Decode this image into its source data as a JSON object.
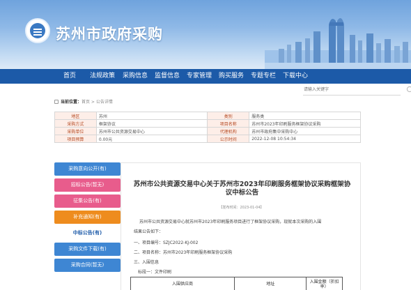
{
  "header": {
    "site_title": "苏州市政府采购"
  },
  "nav": {
    "items": [
      "首页",
      "法规政策",
      "采购信息",
      "监督信息",
      "专家管理",
      "购买服务",
      "专题专栏",
      "下载中心"
    ]
  },
  "search": {
    "placeholder": "请输入关键字"
  },
  "breadcrumb": {
    "label": "当前位置：",
    "path": "首页 > 公告详情"
  },
  "info_table": {
    "rows": [
      {
        "l1": "地区",
        "v1": "苏州",
        "l2": "类别",
        "v2": "服务类"
      },
      {
        "l1": "采购方式",
        "v1": "框架协议",
        "l2": "项目名称",
        "v2": "苏州市2023年印刷服务框架协议采购"
      },
      {
        "l1": "采购单位",
        "v1": "苏州市公共资源交易中心",
        "l2": "代理机构",
        "v2": "苏州市政府集中采购中心"
      },
      {
        "l1": "项目预算",
        "v1": "0.00元",
        "l2": "公示时间",
        "v2": "2022-12-08 10:54:34"
      }
    ]
  },
  "side_menu": {
    "items": [
      {
        "label": "采购意向公开(有)",
        "color": "#3e86d3"
      },
      {
        "label": "招标公告(暂无)",
        "color": "#e85c8c"
      },
      {
        "label": "征集公告(有)",
        "color": "#e85c8c"
      },
      {
        "label": "补充通知(有)",
        "color": "#ee8c1e"
      },
      {
        "label": "中标公告(有)",
        "color": "#ffffff"
      },
      {
        "label": "采购文件下载(有)",
        "color": "#3e86d3"
      },
      {
        "label": "采购合同(暂无)",
        "color": "#3e86d3"
      }
    ]
  },
  "article": {
    "title_line1": "苏州市公共资源交易中心关于苏州市2023年印刷服务框架协议采购框架协",
    "title_line2": "议中标公告",
    "publish_time": "【发布时间：2023-01-04】",
    "para1": "苏州市公共资源交易中心就苏州市2023年印刷服务项目进行了框架协议采购，现就本次采购的入围",
    "para1b": "结果公告如下：",
    "item1": "一、项目编号：SZJC2022-KJ-002",
    "item2": "二、项目名称：苏州市2023年印刷服务框架协议采购",
    "item3": "三、入围信息",
    "item3a": "标段一：文件印刷",
    "table_headers": [
      "入围供应商",
      "地址",
      "入围金额（折扣率）"
    ]
  },
  "colors": {
    "nav_bg": "#1c5aa8",
    "label_bg": "#fdeee8",
    "label_text": "#b3471f"
  }
}
